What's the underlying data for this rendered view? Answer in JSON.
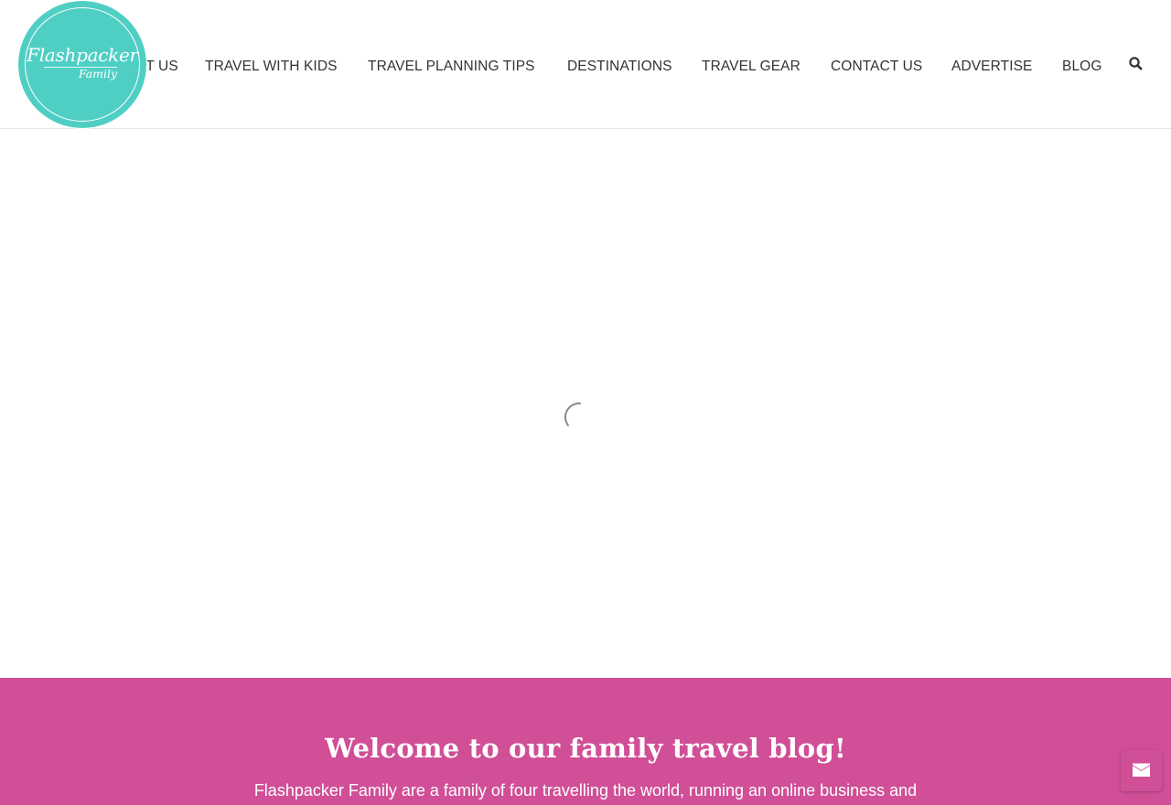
{
  "colors": {
    "brand_teal": "#4fcfc4",
    "brand_pink": "#d04f97",
    "nav_text": "#333333"
  },
  "logo": {
    "line1": "Flashpacker",
    "line2": "Family"
  },
  "nav": {
    "items": [
      {
        "label": "ABOUT US"
      },
      {
        "label": "TRAVEL WITH KIDS"
      },
      {
        "label": "TRAVEL PLANNING TIPS"
      },
      {
        "label": "DESTINATIONS"
      },
      {
        "label": "TRAVEL GEAR"
      },
      {
        "label": "CONTACT US"
      },
      {
        "label": "ADVERTISE"
      },
      {
        "label": "BLOG"
      }
    ],
    "search_icon": "search-icon"
  },
  "welcome": {
    "title": "Welcome to our family travel blog!",
    "text": "Flashpacker Family are a family of four travelling the world, running an online business and"
  },
  "contact_button": {
    "icon": "envelope-icon"
  }
}
